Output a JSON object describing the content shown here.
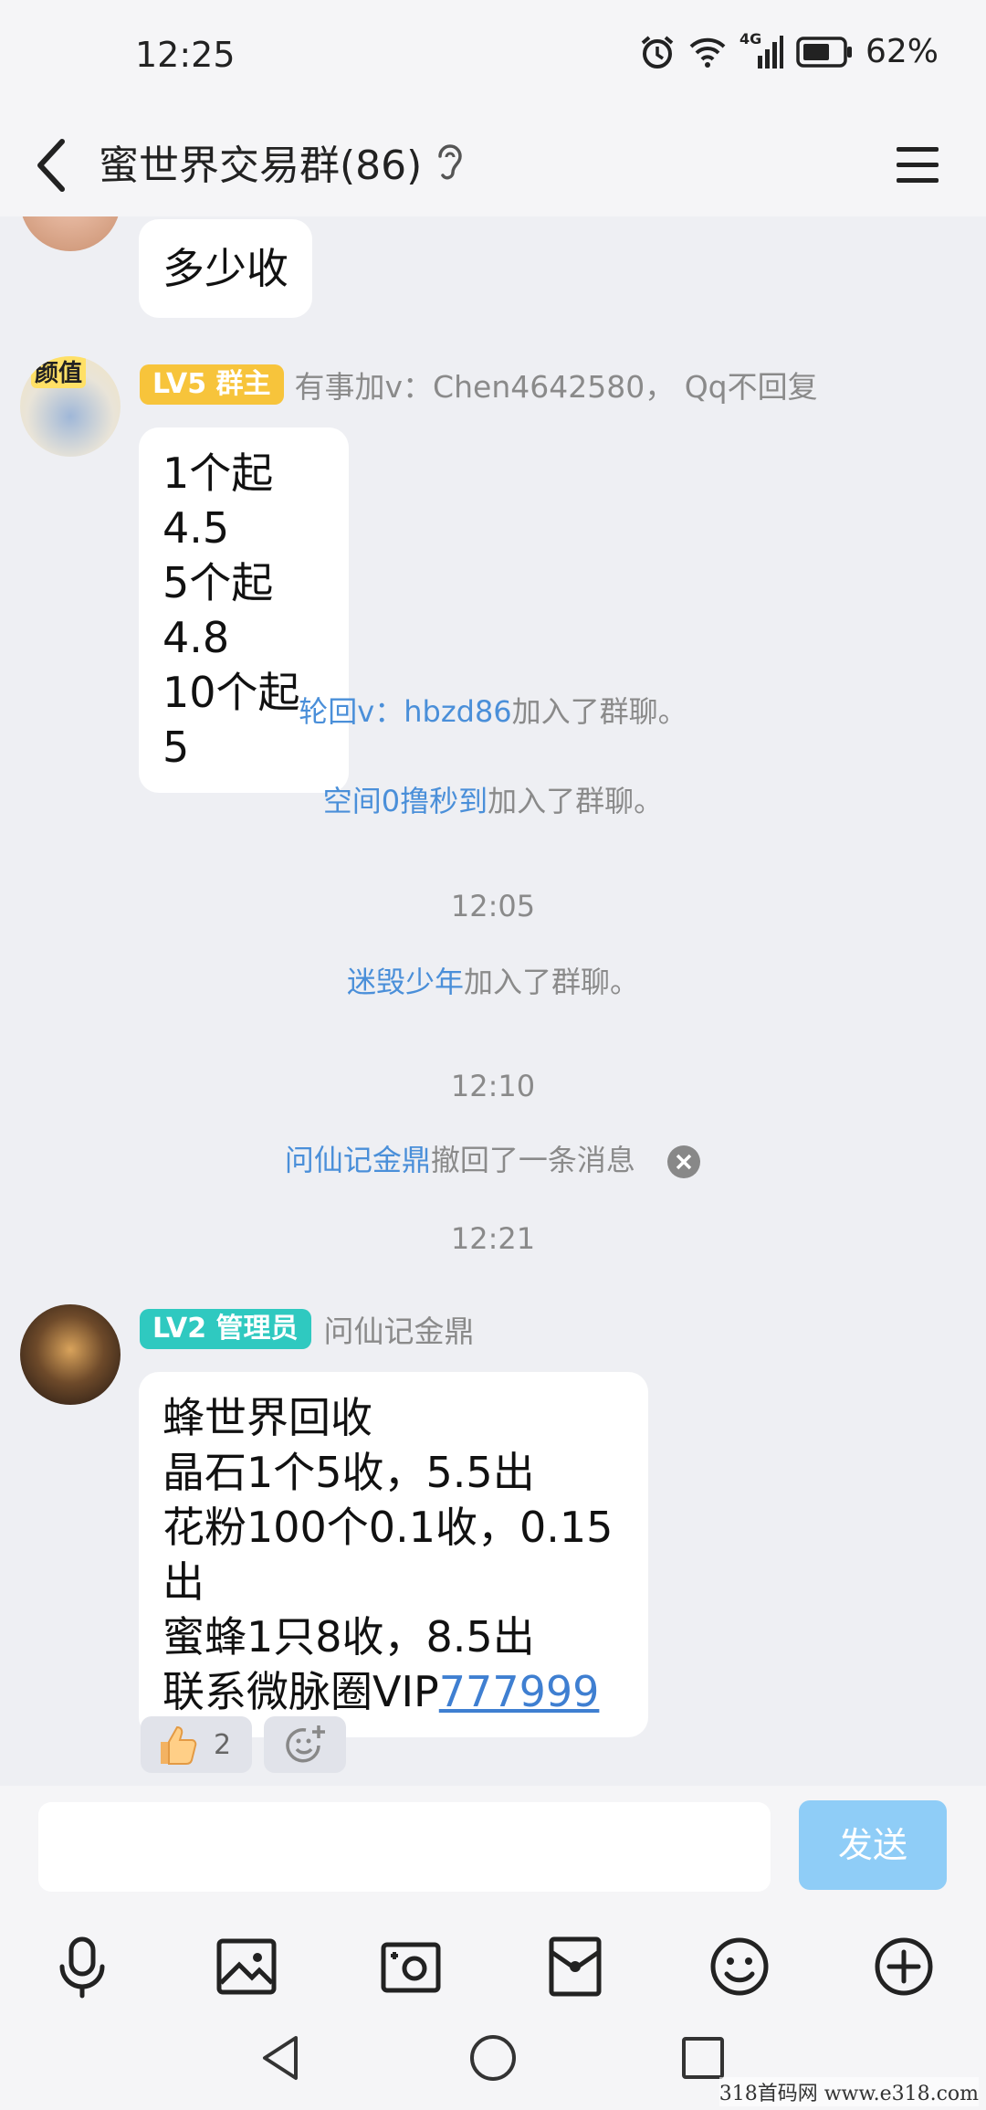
{
  "status_bar": {
    "time": "12:25",
    "battery": "62%",
    "network": "4G"
  },
  "header": {
    "title": "蜜世界交易群(86)"
  },
  "messages": [
    {
      "text": "多少收"
    },
    {
      "badge": "LV5 群主",
      "badge_color": "#f7c43b",
      "sender": "有事加v：Chen4642580， Qq不回复",
      "lines": [
        "1个起4.5",
        "5个起4.8",
        "10个起5"
      ],
      "avatar_text": "颜值"
    },
    {
      "badge": "LV2 管理员",
      "badge_color": "#2fc9c0",
      "sender": "问仙记金鼎",
      "lines": [
        "蜂世界回收",
        "晶石1个5收，5.5出",
        "花粉100个0.1收，0.15出",
        "蜜蜂1只8收，8.5出"
      ],
      "last_line_prefix": "联系微脉圈VIP",
      "last_line_link": "777999"
    }
  ],
  "system": {
    "join1_name": "轮回v：hbzd86",
    "join1_suffix": "加入了群聊。",
    "join2_name": "空间0撸秒到",
    "join2_suffix": "加入了群聊。",
    "time1": "12:05",
    "join3_name": "迷毁少年",
    "join3_suffix": "加入了群聊。",
    "time2": "12:10",
    "recall_name": "问仙记金鼎",
    "recall_suffix": "撤回了一条消息",
    "time3": "12:21"
  },
  "reactions": {
    "like_count": "2"
  },
  "input": {
    "send_label": "发送",
    "placeholder": ""
  },
  "toolbar": {
    "icons": [
      "mic-icon",
      "image-icon",
      "camera-icon",
      "red-packet-icon",
      "emoji-icon",
      "plus-icon"
    ]
  },
  "watermark": "318首码网  www.e318.com"
}
